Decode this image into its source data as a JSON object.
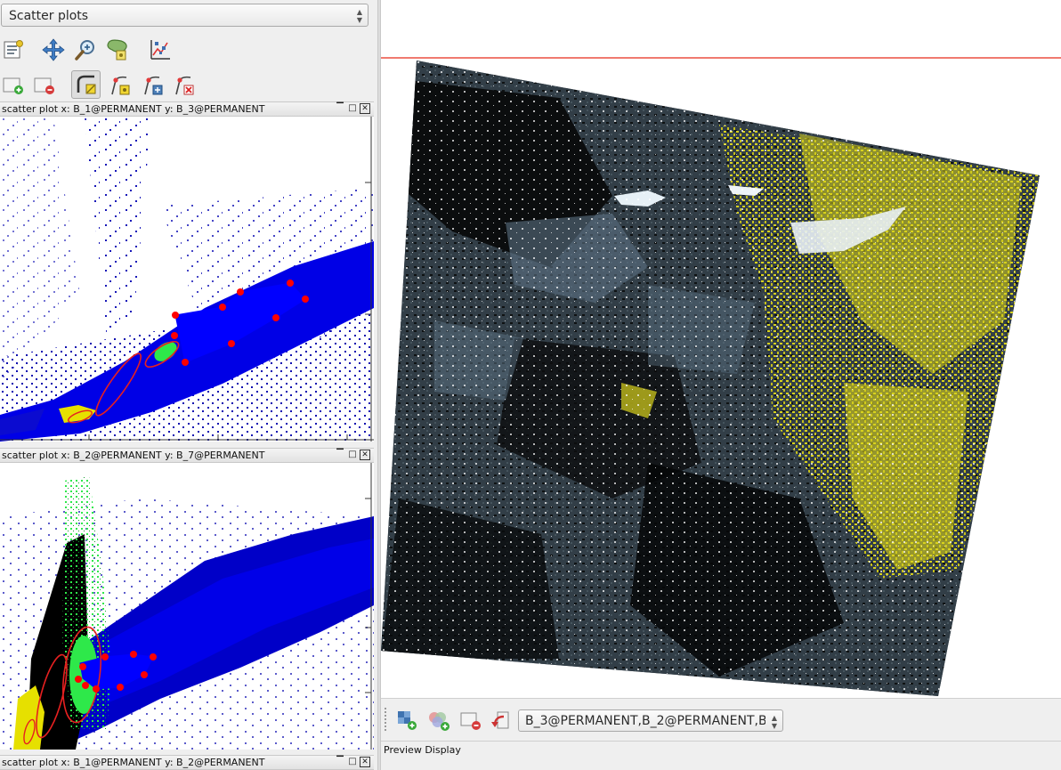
{
  "left_panel": {
    "plot_selector": {
      "value": "Scatter plots"
    },
    "toolbar_row1": [
      {
        "name": "settings-icon"
      },
      {
        "name": "pan-icon"
      },
      {
        "name": "zoom-icon"
      },
      {
        "name": "select-area-icon"
      },
      {
        "name": "chart-icon"
      }
    ],
    "toolbar_row2": [
      {
        "name": "add-category-icon"
      },
      {
        "name": "remove-category-icon"
      },
      {
        "name": "edit-polygon-icon"
      },
      {
        "name": "add-vertex-icon"
      },
      {
        "name": "move-vertex-icon"
      },
      {
        "name": "remove-vertex-icon"
      }
    ],
    "plots": [
      {
        "title": "scatter plot x: B_1@PERMANENT y: B_3@PERMANENT"
      },
      {
        "title": "scatter plot x: B_2@PERMANENT y: B_7@PERMANENT"
      },
      {
        "title": "scatter plot x: B_1@PERMANENT y: B_2@PERMANENT"
      }
    ],
    "window_controls": {
      "minimize": "▔",
      "maximize": "□",
      "close": "✕"
    }
  },
  "map_view": {
    "divider_color": "#f07a6f",
    "colors": {
      "background": "#ffffff",
      "imagery": "#2a3138",
      "highlight": "#d8d21c",
      "water": "#5c7283"
    }
  },
  "bottom_toolbar": {
    "buttons": [
      {
        "name": "add-raster-icon"
      },
      {
        "name": "add-rgb-icon"
      },
      {
        "name": "remove-layer-icon"
      },
      {
        "name": "undo-icon"
      }
    ],
    "layer_select": {
      "value": "B_3@PERMANENT,B_2@PERMANENT,B"
    }
  },
  "preview": {
    "label": "Preview Display"
  },
  "colors": {
    "scatter_density": "#0000e6",
    "category_yellow": "#e6e000",
    "category_green": "#2ee84a",
    "vertex_red": "#ff0000"
  }
}
